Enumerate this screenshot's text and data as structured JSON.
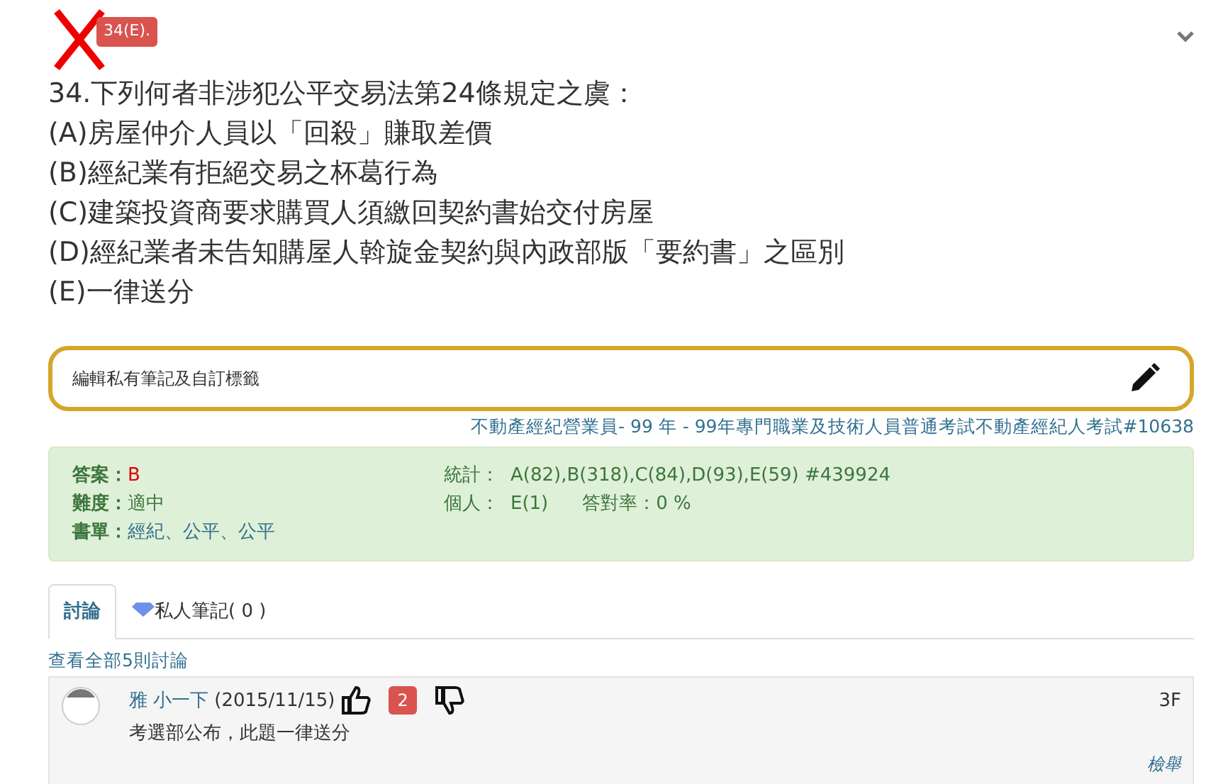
{
  "result": {
    "wrong": true,
    "badge": "34(E)."
  },
  "question": {
    "stem": "34.下列何者非涉犯公平交易法第24條規定之虞：",
    "options": [
      "(A)房屋仲介人員以「回殺」賺取差價",
      "(B)經紀業有拒絕交易之杯葛行為",
      "(C)建築投資商要求購買人須繳回契約書始交付房屋",
      "(D)經紀業者未告知購屋人斡旋金契約與內政部版「要約書」之區別",
      "(E)一律送分"
    ]
  },
  "note_field": {
    "placeholder": "編輯私有筆記及自訂標籤"
  },
  "source": "不動產經紀營業員- 99 年 - 99年專門職業及技術人員普通考試不動產經紀人考試#10638",
  "info": {
    "answer_label": "答案：",
    "answer": "B",
    "difficulty_label": "難度：",
    "difficulty": "適中",
    "booklist_label": "書單：",
    "booklist": "經紀、公平、公平",
    "stats_label": "統計：",
    "stats": "A(82),B(318),C(84),D(93),E(59) #439924",
    "personal_label": "個人：",
    "personal": "E(1)",
    "rate_label": "答對率：0 %"
  },
  "tabs": [
    {
      "label": "討論",
      "selected": true,
      "kind": "plain"
    },
    {
      "label": "私人筆記( 0 )",
      "selected": false,
      "kind": "gem"
    }
  ],
  "view_all": "查看全部5則討論",
  "comment": {
    "author": "雅 小一下",
    "date": "(2015/11/15)",
    "likes": "2",
    "floor": "3F",
    "text": "考選部公布，此題一律送分",
    "report": "檢舉"
  }
}
